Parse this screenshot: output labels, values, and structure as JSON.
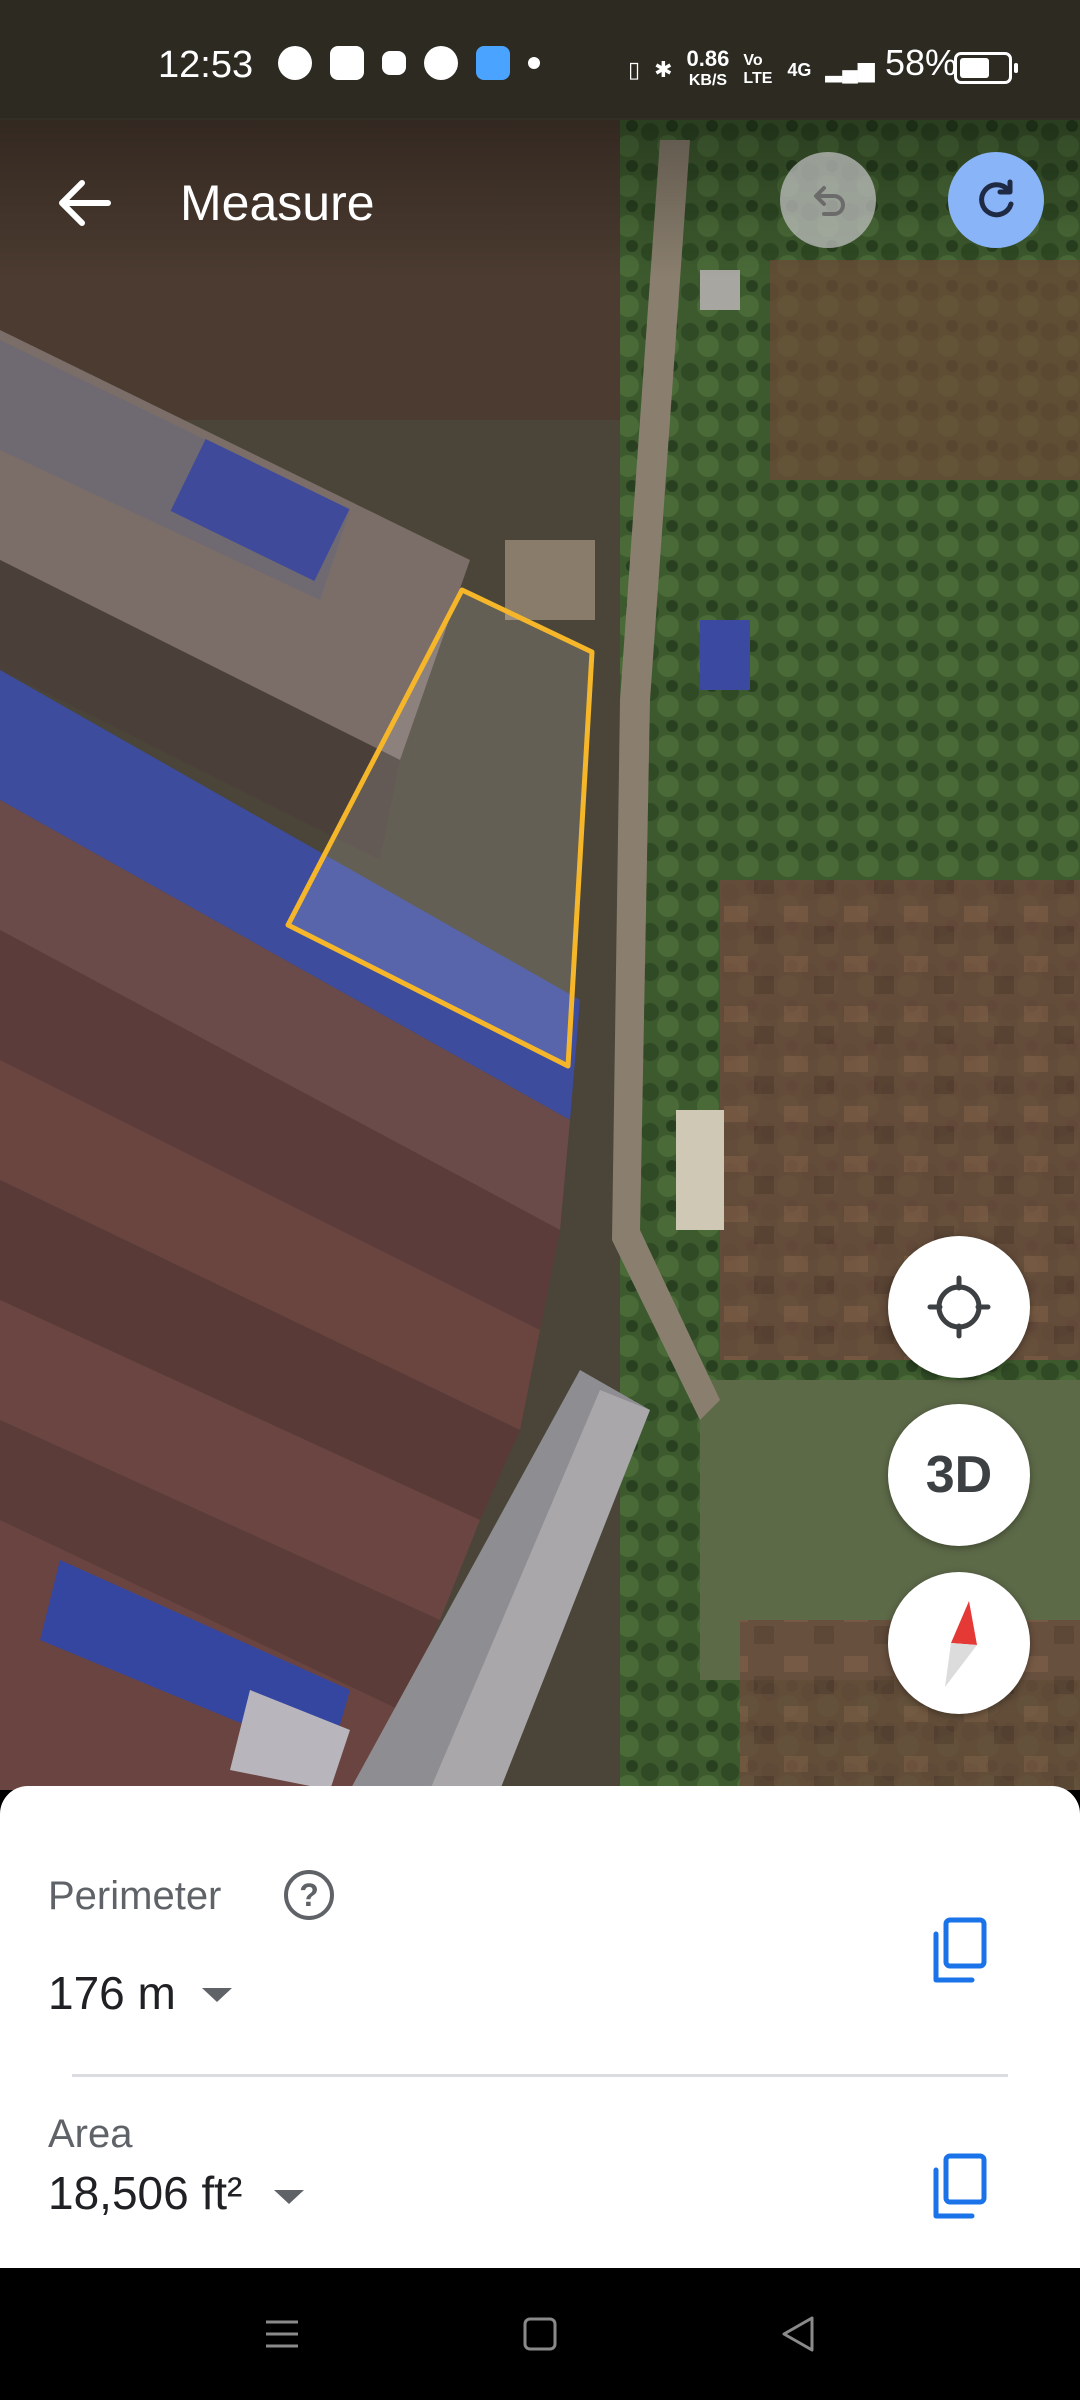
{
  "status_bar": {
    "time": "12:53",
    "net_speed": "0.86",
    "net_speed_unit": "KB/S",
    "volte": "Vo LTE",
    "network": "4G",
    "battery": "58%"
  },
  "header": {
    "title": "Measure",
    "back_icon": "arrow-back-icon",
    "undo_icon": "undo-icon",
    "redo_icon": "redo-icon"
  },
  "map_controls": {
    "locate_icon": "my-location-icon",
    "three_d_label": "3D",
    "compass_icon": "compass-icon"
  },
  "measurement": {
    "perimeter_label": "Perimeter",
    "perimeter_value": "176 m",
    "area_label": "Area",
    "area_value": "18,506 ft²"
  },
  "colors": {
    "polygon_outline": "#f5b62a",
    "redo_button": "#8ab4f8",
    "copy_icon": "#1a73e8"
  }
}
